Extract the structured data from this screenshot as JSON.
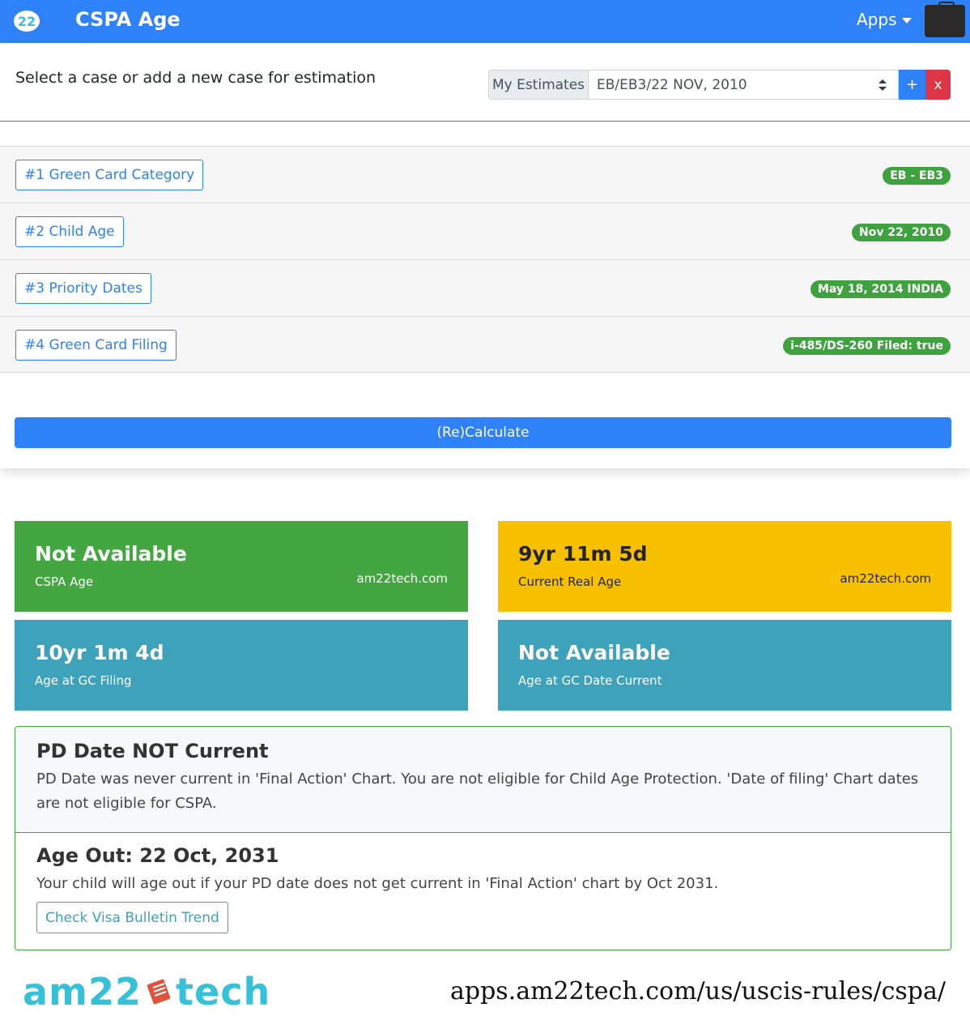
{
  "navbar": {
    "logo_text": "22",
    "title": "CSPA Age",
    "apps_label": "Apps"
  },
  "top": {
    "instruction": "Select a case or add a new case for estimation",
    "estimates_label": "My Estimates",
    "selected_estimate": "EB/EB3/22 NOV, 2010",
    "add_label": "+",
    "delete_label": "x"
  },
  "steps": [
    {
      "label": "#1 Green Card Category",
      "badge": "EB - EB3"
    },
    {
      "label": "#2 Child Age",
      "badge": "Nov 22, 2010"
    },
    {
      "label": "#3 Priority Dates",
      "badge": "May 18, 2014 INDIA"
    },
    {
      "label": "#4 Green Card Filing",
      "badge": "i-485/DS-260 Filed: true"
    }
  ],
  "recalculate_label": "(Re)Calculate",
  "tiles": {
    "cspa_age": {
      "value": "Not Available",
      "label": "CSPA Age",
      "site": "am22tech.com"
    },
    "real_age": {
      "value": "9yr 11m 5d",
      "label": "Current Real Age",
      "site": "am22tech.com"
    },
    "gc_filing_age": {
      "value": "10yr 1m 4d",
      "label": "Age at GC Filing"
    },
    "gc_current_age": {
      "value": "Not Available",
      "label": "Age at GC Date Current"
    }
  },
  "result": {
    "heading": "PD Date NOT Current",
    "text": "PD Date was never current in 'Final Action' Chart. You are not eligible for Child Age Protection. 'Date of filing' Chart dates are not eligible for CSPA.",
    "ageout_heading": "Age Out: 22 Oct, 2031",
    "ageout_text": "Your child will age out if your PD date does not get current in 'Final Action' chart by Oct 2031.",
    "trend_button": "Check Visa Bulletin Trend"
  },
  "footer": {
    "logo_left": "am22",
    "logo_right": "tech",
    "url": "apps.am22tech.com/us/uscis-rules/cspa/"
  },
  "colors": {
    "primary": "#2f81f7",
    "success": "#44a641",
    "warning": "#f7c000",
    "info": "#3fa2bb",
    "danger": "#dc3545"
  },
  "icons": {
    "logo": "am22-logo-icon",
    "apps_caret": "caret-down-icon",
    "case": "briefcase-icon",
    "select_arrows": "select-arrows-icon"
  }
}
